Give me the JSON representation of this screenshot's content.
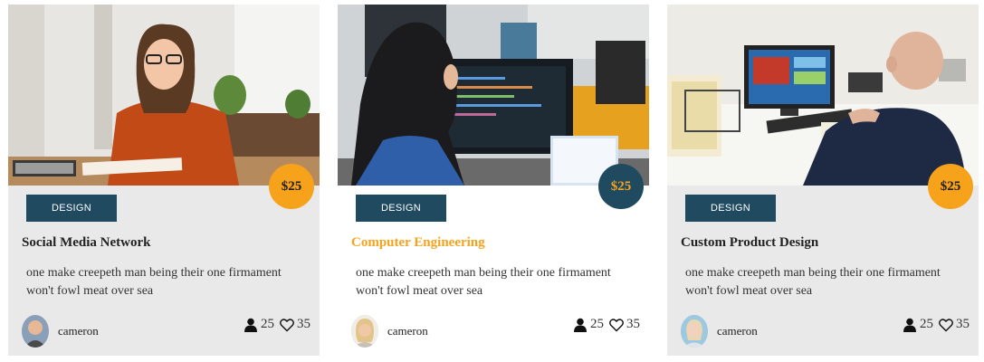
{
  "cards": [
    {
      "price": "$25",
      "tag": "DESIGN",
      "title": "Social Media Network",
      "description": "one make creepeth man being their one firmament won't fowl meat over sea",
      "author": "cameron",
      "students": "25",
      "likes": "35",
      "image_icon": "woman-at-desk-photo"
    },
    {
      "price": "$25",
      "tag": "DESIGN",
      "title": "Computer Engineering",
      "description": "one make creepeth man being their one firmament won't fowl meat over sea",
      "author": "cameron",
      "students": "25",
      "likes": "35",
      "image_icon": "woman-coding-photo"
    },
    {
      "price": "$25",
      "tag": "DESIGN",
      "title": "Custom Product Design",
      "description": "one make creepeth man being their one firmament won't fowl meat over sea",
      "author": "cameron",
      "students": "25",
      "likes": "35",
      "image_icon": "man-at-computer-photo"
    }
  ],
  "colors": {
    "accent": "#f7a21b",
    "navy": "#1f4a60",
    "card_bg": "#e9e9e9"
  }
}
